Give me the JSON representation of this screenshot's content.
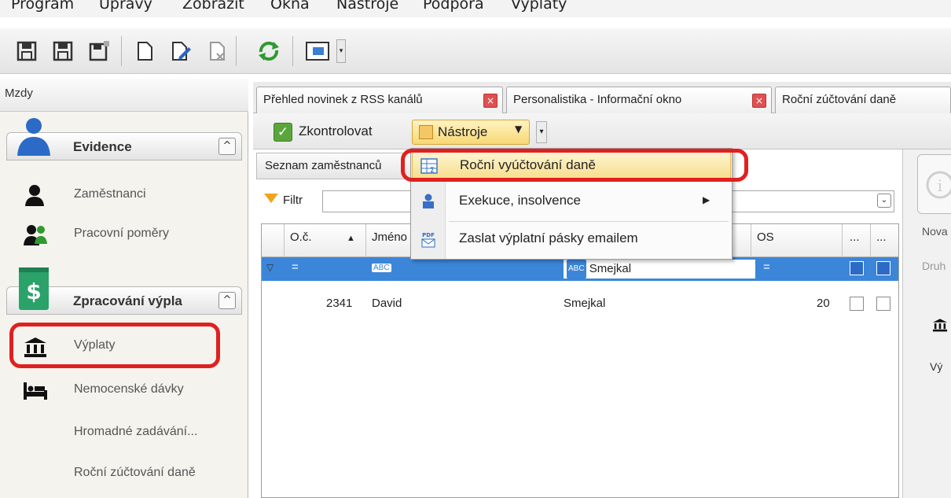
{
  "menubar": {
    "items": [
      "Program",
      "Úpravy",
      "Zobrazit",
      "Okna",
      "Nástroje",
      "Podpora",
      "Výplaty"
    ]
  },
  "leftpanel": {
    "title": "Mzdy",
    "groups": [
      {
        "title": "Evidence",
        "items": [
          {
            "label": "Zaměstnanci",
            "icon": "person-icon"
          },
          {
            "label": "Pracovní poměry",
            "icon": "people-icon"
          }
        ]
      },
      {
        "title": "Zpracování výpla",
        "items": [
          {
            "label": "Výplaty",
            "icon": "bank-icon"
          },
          {
            "label": "Nemocenské dávky",
            "icon": "bed-icon"
          },
          {
            "label": "Hromadné zadávání...",
            "icon": ""
          },
          {
            "label": "Roční zúčtování daně",
            "icon": ""
          }
        ]
      }
    ]
  },
  "tabs": [
    {
      "label": "Přehled novinek z RSS kanálů"
    },
    {
      "label": "Personalistika - Informační okno"
    },
    {
      "label": "Roční zúčtování daně"
    }
  ],
  "subtoolbar": {
    "check_label": "Zkontrolovat",
    "tools_label": "Nástroje"
  },
  "list": {
    "header": "Seznam zaměstnanců",
    "filter_label": "Filtr",
    "columns": [
      "O.č.",
      "Jméno",
      "OS",
      "...",
      "..."
    ],
    "filter_row": {
      "op1": "=",
      "abc": "ABC",
      "name_filter": "Smejkal",
      "op2": "="
    },
    "rows": [
      {
        "oc": "2341",
        "jmeno": "David",
        "prijmeni": "Smejkal",
        "os": "20"
      }
    ]
  },
  "dropdown": {
    "items": [
      {
        "label": "Roční vyúčtování daně",
        "icon": "table-sum-icon"
      },
      {
        "label": "Exekuce, insolvence",
        "icon": "judge-icon"
      },
      {
        "label": "Zaslat výplatní pásky emailem",
        "icon": "pdf-mail-icon"
      }
    ]
  },
  "rightfragment": {
    "nova": "Nova",
    "druh": "Druh",
    "vy": "Vý"
  },
  "colors": {
    "annotation": "#e02020",
    "highlight": "#3b86d8"
  }
}
